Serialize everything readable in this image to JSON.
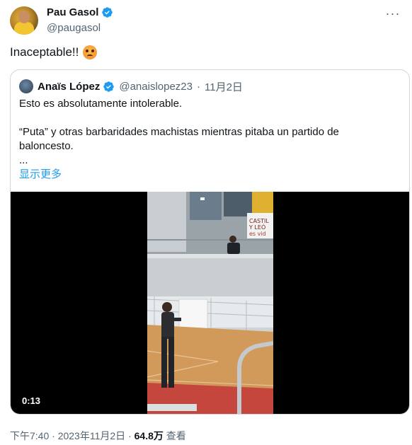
{
  "author": {
    "name": "Pau Gasol",
    "handle": "@paugasol",
    "avatar": "avatar-pau-gasol",
    "verified_icon": "verified-badge-icon"
  },
  "tweet": {
    "text": "Inaceptable!!",
    "emoji": "angry-face-emoji"
  },
  "quoted_tweet": {
    "name": "Anaïs López",
    "handle": "@anaislopez23",
    "separator": "·",
    "date": "11月2日",
    "lines": [
      "Esto es absolutamente intolerable.",
      "“Puta” y otras barbaridades machistas mientras pitaba un partido de",
      "baloncesto.",
      "..."
    ],
    "show_more": "显示更多",
    "video": {
      "duration": "0:13",
      "banner_line1": "CASTIL",
      "banner_line2": "Y LEÓ",
      "banner_line3": "es vid"
    }
  },
  "footer": {
    "time": "下午7:40",
    "separator": "·",
    "date": "2023年11月2日",
    "views_count": "64.8万",
    "views_label": "查看"
  },
  "menu": {
    "more": "···"
  },
  "colors": {
    "accent": "#1d9bf0",
    "secondary_text": "#536471",
    "border": "#cfd9de"
  }
}
